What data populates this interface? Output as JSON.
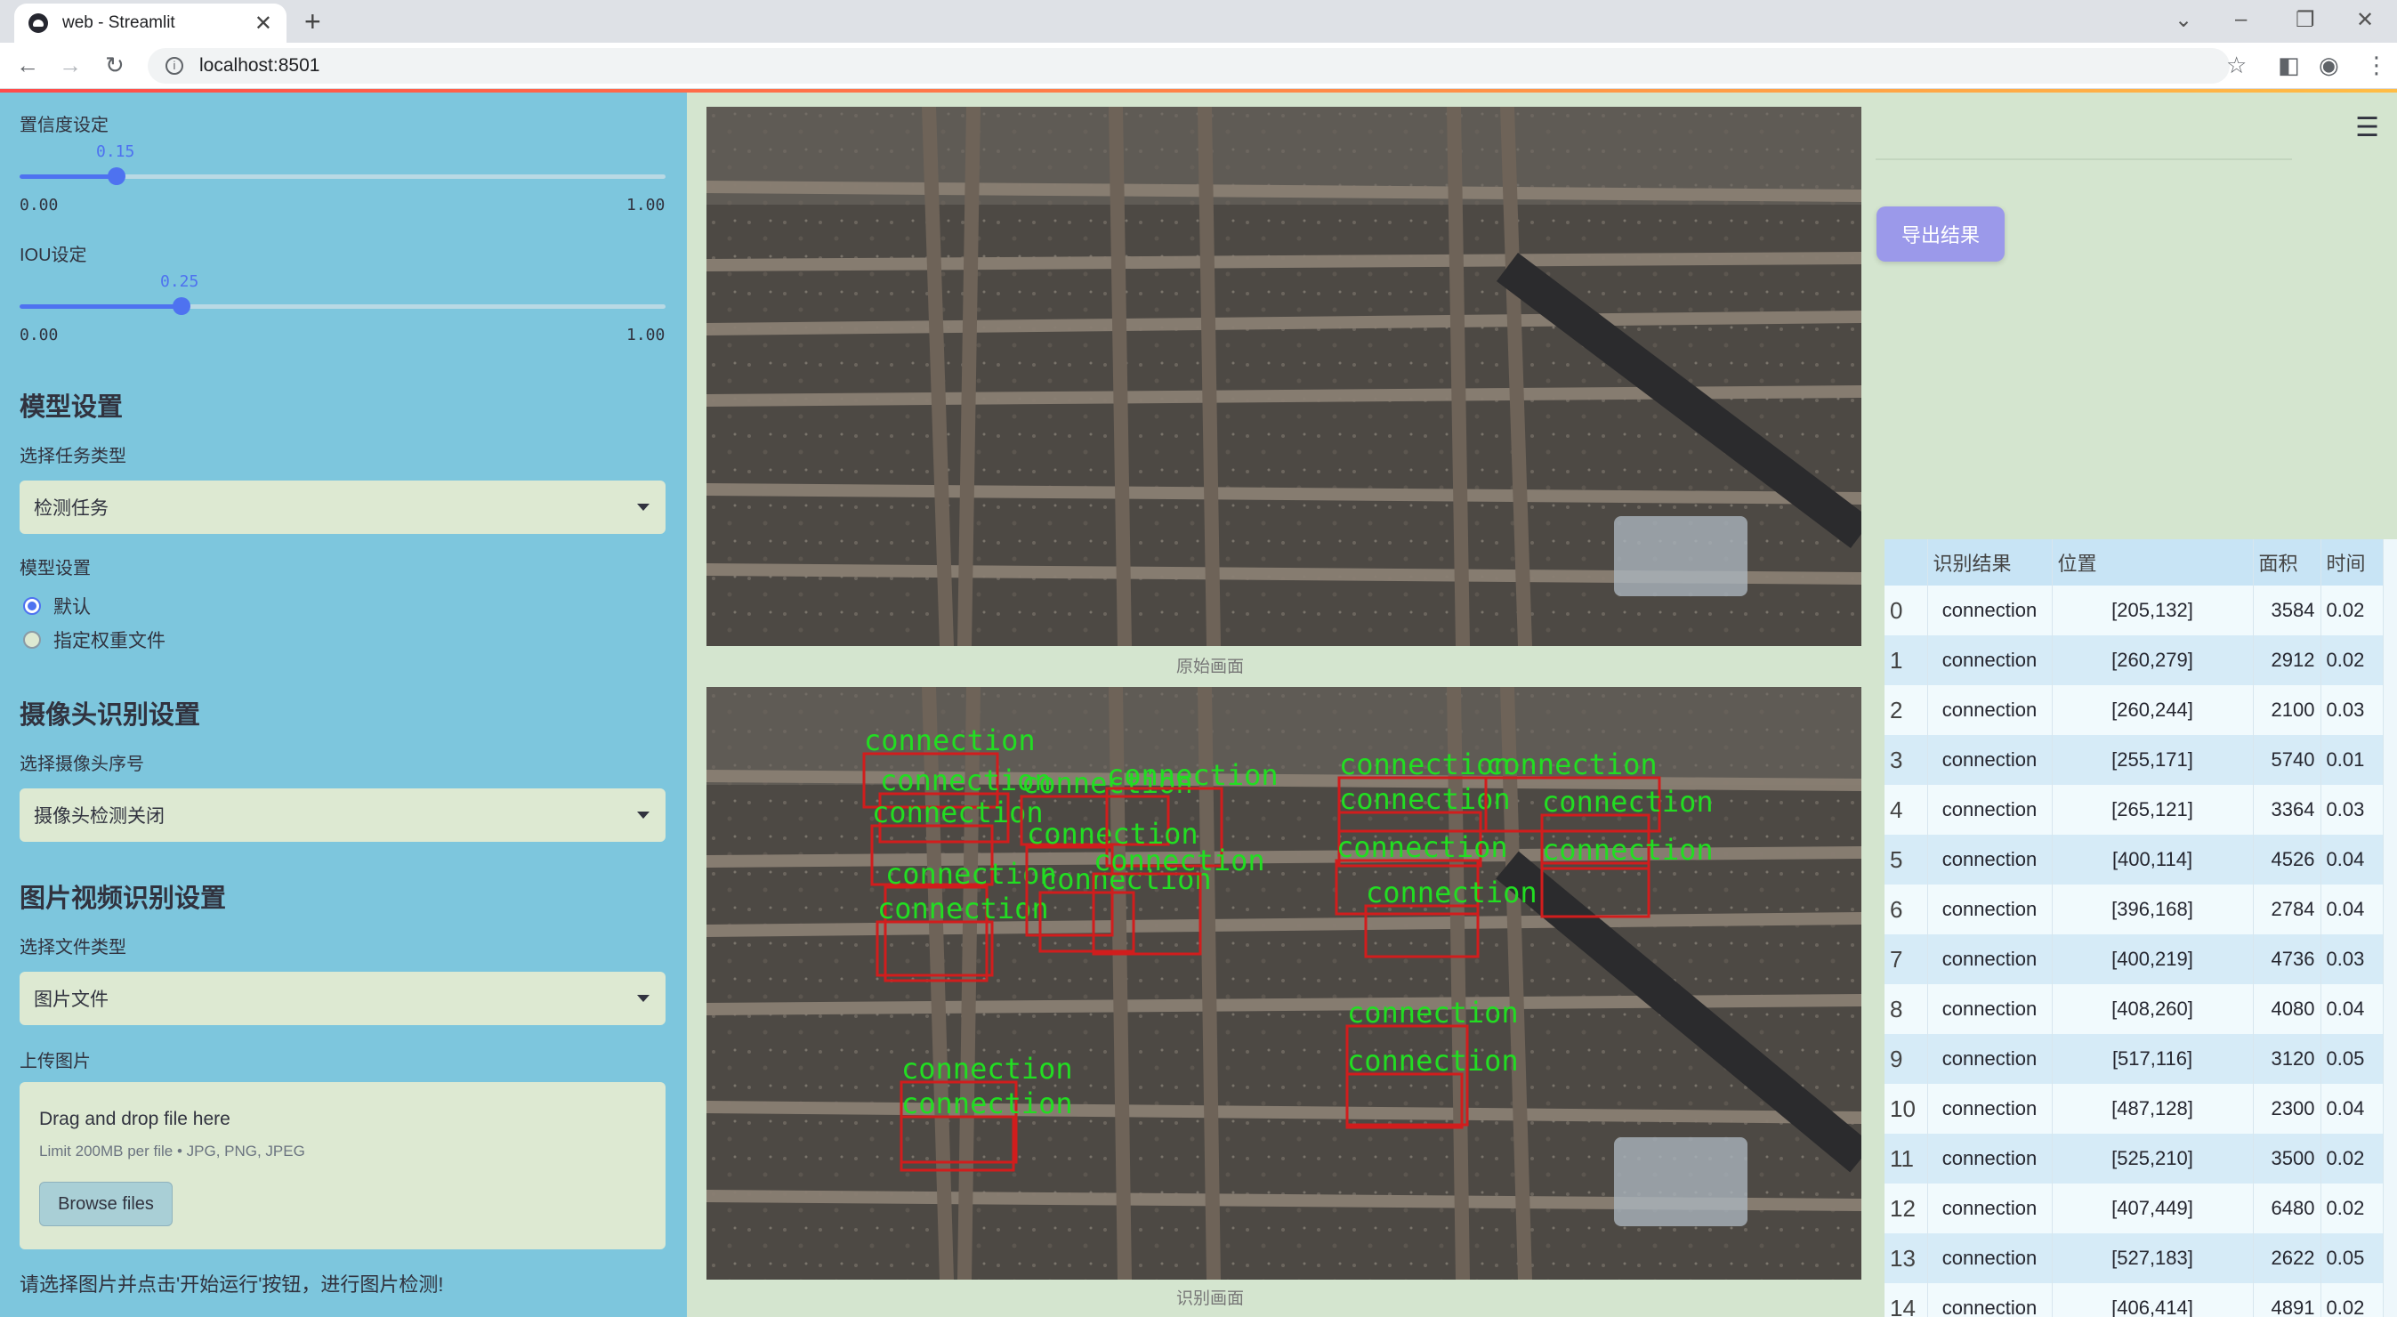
{
  "browser": {
    "tab_title": "web - Streamlit",
    "url": "localhost:8501"
  },
  "sidebar": {
    "conf": {
      "label": "置信度设定",
      "value": "0.15",
      "min": "0.00",
      "max": "1.00",
      "level": 0.15
    },
    "iou": {
      "label": "IOU设定",
      "value": "0.25",
      "min": "0.00",
      "max": "1.00",
      "level": 0.25
    },
    "model_section": "模型设置",
    "task_label": "选择任务类型",
    "task_value": "检测任务",
    "model_label": "模型设置",
    "radio_default": "默认",
    "radio_custom": "指定权重文件",
    "camera_section": "摄像头识别设置",
    "camera_label": "选择摄像头序号",
    "camera_value": "摄像头检测关闭",
    "media_section": "图片视频识别设置",
    "filetype_label": "选择文件类型",
    "filetype_value": "图片文件",
    "upload_label": "上传图片",
    "upload_drag": "Drag and drop file here",
    "upload_limit": "Limit 200MB per file • JPG, PNG, JPEG",
    "upload_button": "Browse files",
    "hint": "请选择图片并点击'开始运行'按钮，进行图片检测!"
  },
  "main": {
    "original_caption": "原始画面",
    "result_caption": "识别画面",
    "export_button": "导出结果",
    "detection_label": "connection"
  },
  "table": {
    "headers": [
      "",
      "识别结果",
      "位置",
      "面积",
      "时间"
    ],
    "rows": [
      {
        "idx": "0",
        "cls": "connection",
        "pos": "[205,132]",
        "area": "3584",
        "time": "0.02"
      },
      {
        "idx": "1",
        "cls": "connection",
        "pos": "[260,279]",
        "area": "2912",
        "time": "0.02"
      },
      {
        "idx": "2",
        "cls": "connection",
        "pos": "[260,244]",
        "area": "2100",
        "time": "0.03"
      },
      {
        "idx": "3",
        "cls": "connection",
        "pos": "[255,171]",
        "area": "5740",
        "time": "0.01"
      },
      {
        "idx": "4",
        "cls": "connection",
        "pos": "[265,121]",
        "area": "3364",
        "time": "0.03"
      },
      {
        "idx": "5",
        "cls": "connection",
        "pos": "[400,114]",
        "area": "4526",
        "time": "0.04"
      },
      {
        "idx": "6",
        "cls": "connection",
        "pos": "[396,168]",
        "area": "2784",
        "time": "0.04"
      },
      {
        "idx": "7",
        "cls": "connection",
        "pos": "[400,219]",
        "area": "4736",
        "time": "0.03"
      },
      {
        "idx": "8",
        "cls": "connection",
        "pos": "[408,260]",
        "area": "4080",
        "time": "0.04"
      },
      {
        "idx": "9",
        "cls": "connection",
        "pos": "[517,116]",
        "area": "3120",
        "time": "0.05"
      },
      {
        "idx": "10",
        "cls": "connection",
        "pos": "[487,128]",
        "area": "2300",
        "time": "0.04"
      },
      {
        "idx": "11",
        "cls": "connection",
        "pos": "[525,210]",
        "area": "3500",
        "time": "0.02"
      },
      {
        "idx": "12",
        "cls": "connection",
        "pos": "[407,449]",
        "area": "6480",
        "time": "0.02"
      },
      {
        "idx": "13",
        "cls": "connection",
        "pos": "[527,183]",
        "area": "2622",
        "time": "0.05"
      },
      {
        "idx": "14",
        "cls": "connection",
        "pos": "[406,414]",
        "area": "4891",
        "time": "0.02"
      }
    ]
  }
}
